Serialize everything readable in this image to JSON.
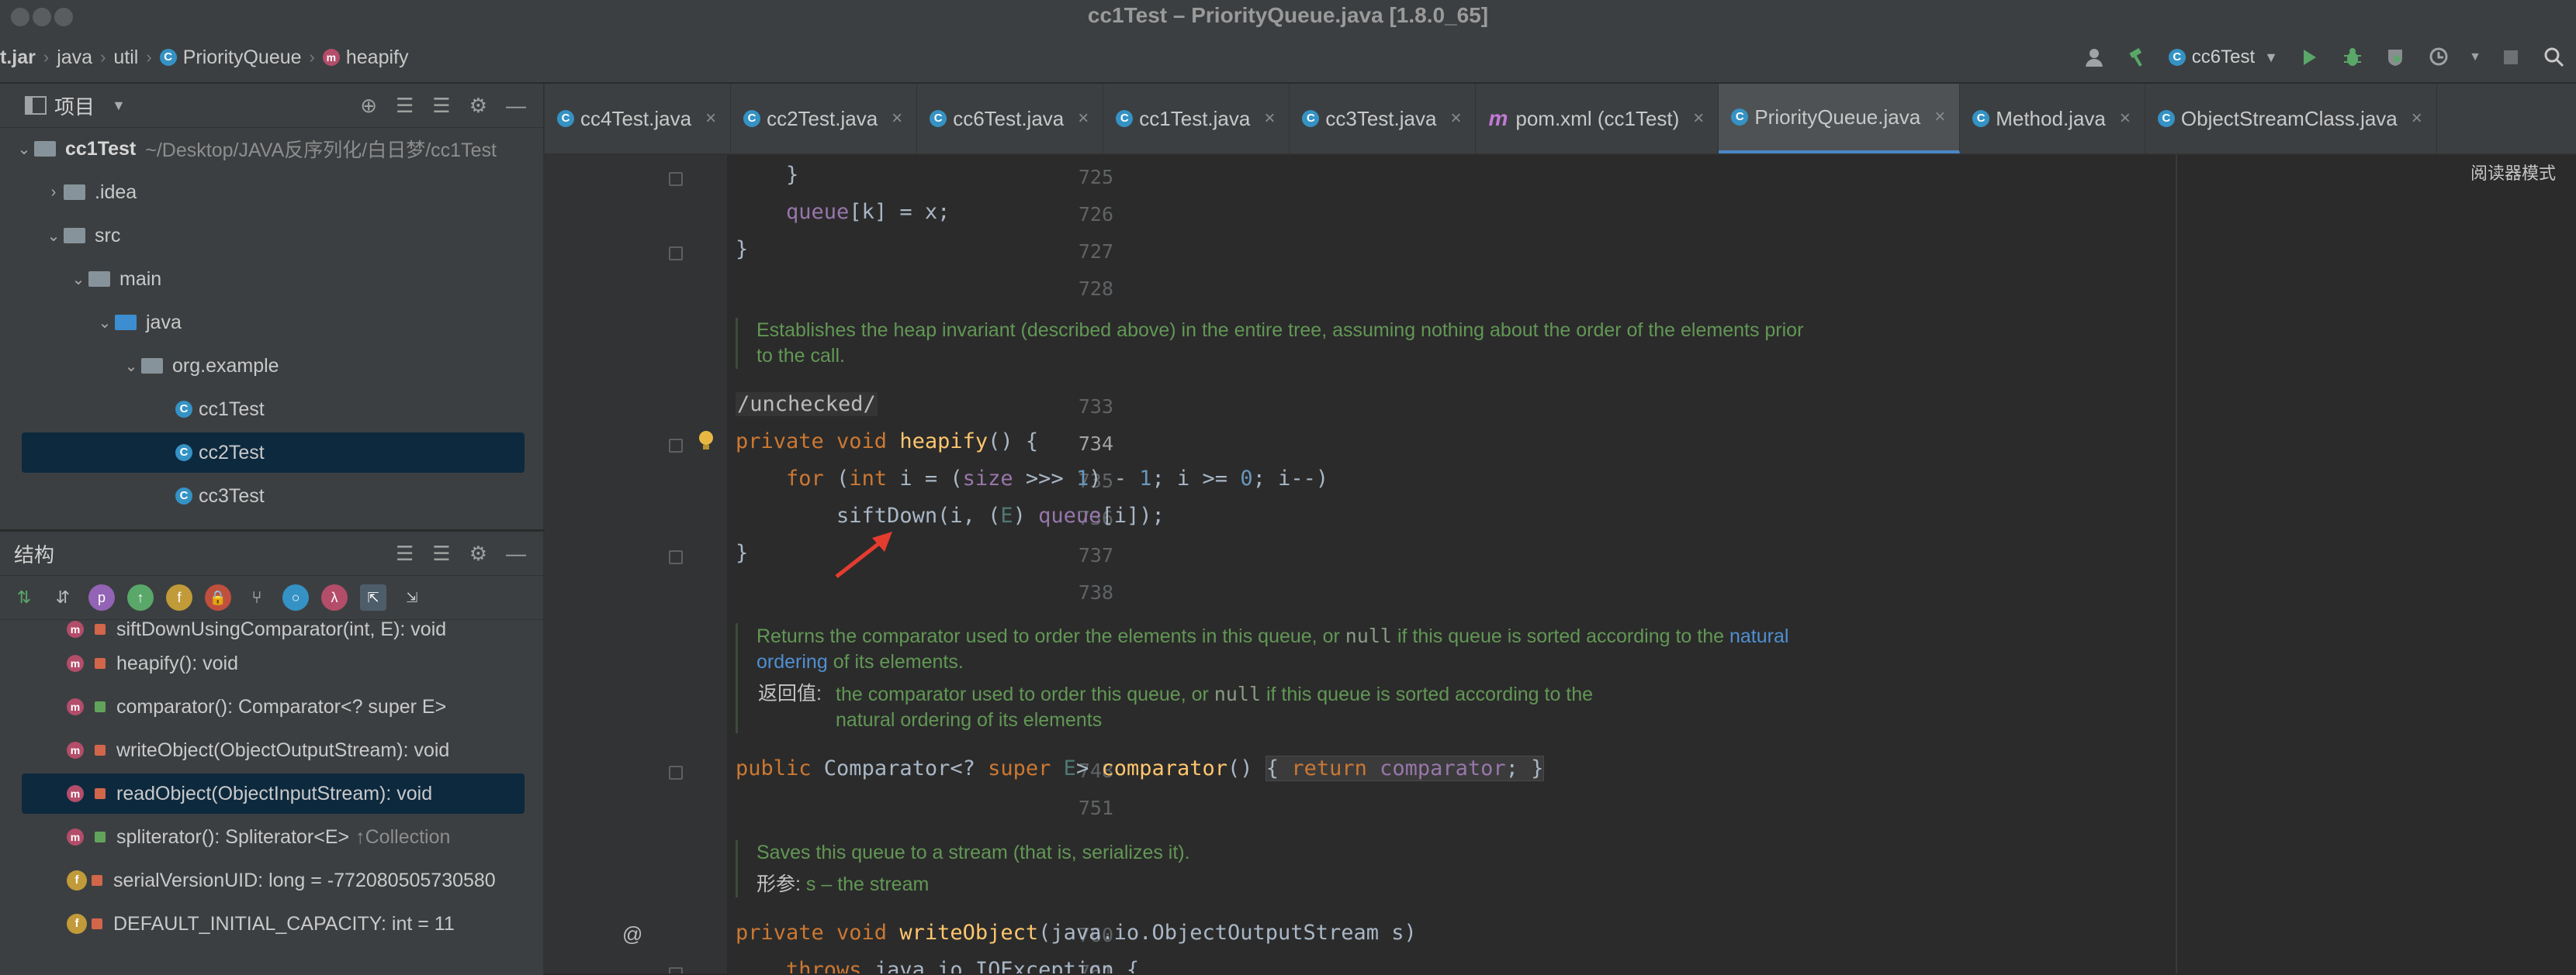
{
  "window": {
    "title": "cc1Test – PriorityQueue.java [1.8.0_65]"
  },
  "breadcrumbs": [
    {
      "label": "t.jar",
      "icon": "none"
    },
    {
      "label": "java",
      "icon": "none"
    },
    {
      "label": "util",
      "icon": "none"
    },
    {
      "label": "PriorityQueue",
      "icon": "class-icon"
    },
    {
      "label": "heapify",
      "icon": "method-icon"
    }
  ],
  "toolbar": {
    "run_config": "cc6Test"
  },
  "project": {
    "title": "项目",
    "root_name": "cc1Test",
    "root_path": "~/Desktop/JAVA反序列化/白日梦/cc1Test",
    "idea": ".idea",
    "src": "src",
    "main": "main",
    "java": "java",
    "package": "org.example",
    "files": [
      "cc1Test",
      "cc2Test",
      "cc3Test"
    ]
  },
  "structure": {
    "title": "结构",
    "items": [
      "siftDownUsingComparator(int, E): void",
      "heapify(): void",
      "comparator(): Comparator<? super E>",
      "writeObject(ObjectOutputStream): void",
      "readObject(ObjectInputStream): void",
      "spliterator(): Spliterator<E>",
      "serialVersionUID: long = -772080505730580",
      "DEFAULT_INITIAL_CAPACITY: int = 11"
    ],
    "spliterator_suffix": "↑Collection"
  },
  "tabs": [
    "cc4Test.java",
    "cc2Test.java",
    "cc6Test.java",
    "cc1Test.java",
    "cc3Test.java",
    "pom.xml (cc1Test)",
    "PriorityQueue.java",
    "Method.java",
    "ObjectStreamClass.java"
  ],
  "active_tab": "PriorityQueue.java",
  "editor": {
    "reader_mode": "阅读器模式",
    "line_numbers": [
      "725",
      "726",
      "727",
      "728",
      "733",
      "734",
      "735",
      "736",
      "737",
      "738",
      "748",
      "751",
      "760",
      "761"
    ],
    "annotation": "/unchecked/",
    "doc1": "Establishes the heap invariant (described above) in the entire tree, assuming nothing about the order of the elements prior to the call.",
    "doc2_a": "Returns the comparator used to order the elements in this queue, or",
    "doc2_null": "null",
    "doc2_b": "if this queue is sorted according to the",
    "doc2_link": "natural ordering",
    "doc2_c": "of its elements.",
    "doc2_return_label": "返回值:",
    "doc2_return_a": "the comparator used to order this queue, or",
    "doc2_return_b": "if this queue is sorted according to the natural ordering of its elements",
    "doc3": "Saves this queue to a stream (that is, serializes it).",
    "doc3_param_label": "形参:",
    "doc3_param": "s – the stream",
    "at_sign": "@"
  },
  "colors": {
    "selection": "#0d293e",
    "keyword": "#cc7832",
    "function": "#ffc66d",
    "field": "#9876aa",
    "doc": "#629755",
    "accent": "#4a88c7"
  }
}
